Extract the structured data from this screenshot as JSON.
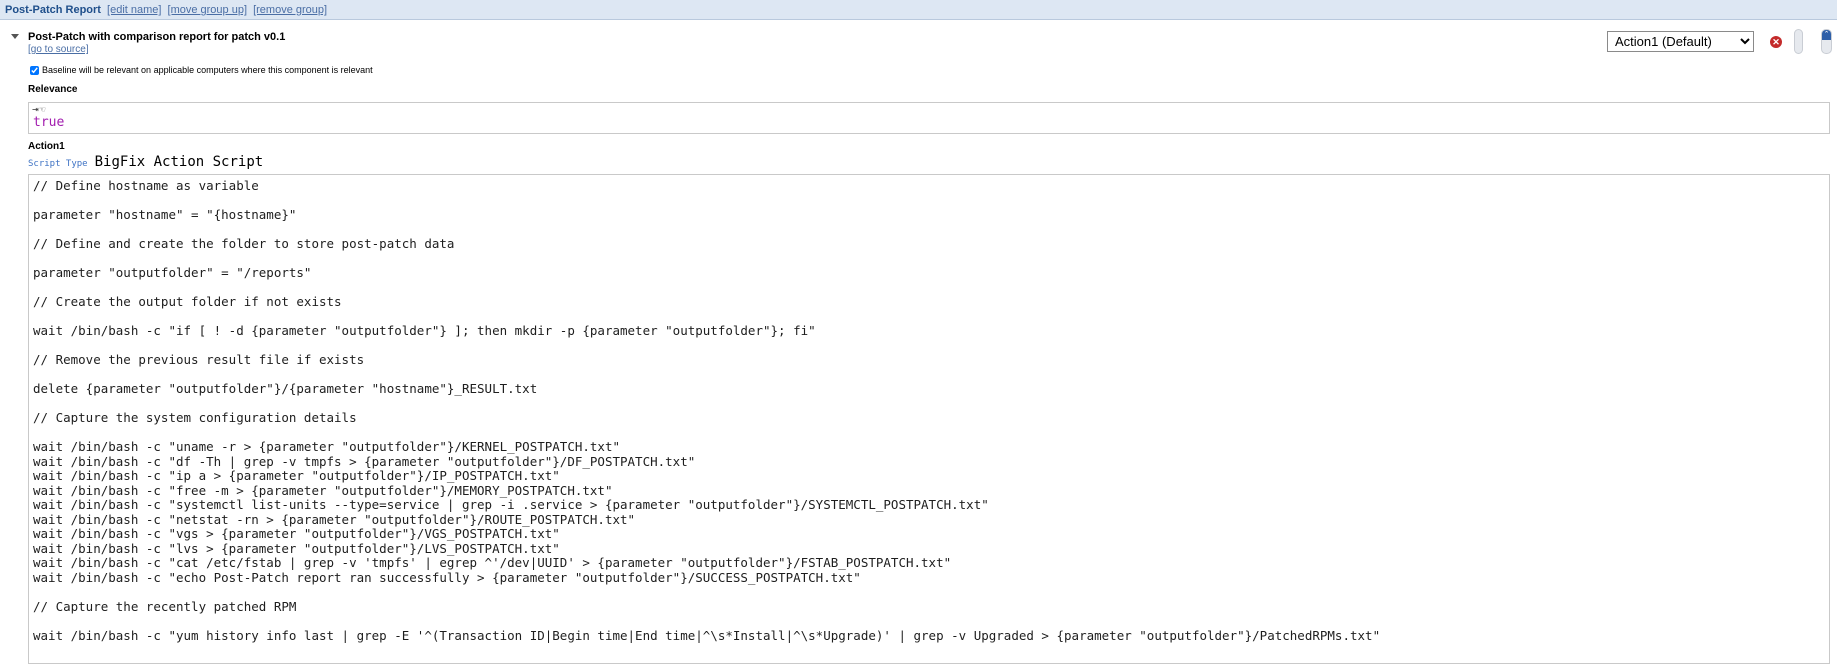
{
  "group": {
    "name": "Post-Patch Report",
    "links": [
      "[edit name]",
      "[move group up]",
      "[remove group]"
    ]
  },
  "component": {
    "title": "Post-Patch with comparison report for patch v0.1",
    "source_link": "[go to source]",
    "action_selector": {
      "selected": "Action1 (Default)"
    },
    "baseline_checkbox": {
      "label": "Baseline will be relevant on applicable computers where this component is relevant",
      "checked": true
    }
  },
  "relevance": {
    "label": "Relevance",
    "value": "true"
  },
  "action": {
    "name": "Action1",
    "script_type_label": "Script Type",
    "script_type": "BigFix Action Script",
    "script_lines": [
      "// Define hostname as variable",
      "",
      "parameter \"hostname\" = \"{hostname}\"",
      "",
      "// Define and create the folder to store post-patch data",
      "",
      "parameter \"outputfolder\" = \"/reports\"",
      "",
      "// Create the output folder if not exists",
      "",
      "wait /bin/bash -c \"if [ ! -d {parameter \"outputfolder\"} ]; then mkdir -p {parameter \"outputfolder\"}; fi\"",
      "",
      "// Remove the previous result file if exists",
      "",
      "delete {parameter \"outputfolder\"}/{parameter \"hostname\"}_RESULT.txt",
      "",
      "// Capture the system configuration details",
      "",
      "wait /bin/bash -c \"uname -r > {parameter \"outputfolder\"}/KERNEL_POSTPATCH.txt\"",
      "wait /bin/bash -c \"df -Th | grep -v tmpfs > {parameter \"outputfolder\"}/DF_POSTPATCH.txt\"",
      "wait /bin/bash -c \"ip a > {parameter \"outputfolder\"}/IP_POSTPATCH.txt\"",
      "wait /bin/bash -c \"free -m > {parameter \"outputfolder\"}/MEMORY_POSTPATCH.txt\"",
      "wait /bin/bash -c \"systemctl list-units --type=service | grep -i .service > {parameter \"outputfolder\"}/SYSTEMCTL_POSTPATCH.txt\"",
      "wait /bin/bash -c \"netstat -rn > {parameter \"outputfolder\"}/ROUTE_POSTPATCH.txt\"",
      "wait /bin/bash -c \"vgs > {parameter \"outputfolder\"}/VGS_POSTPATCH.txt\"",
      "wait /bin/bash -c \"lvs > {parameter \"outputfolder\"}/LVS_POSTPATCH.txt\"",
      "wait /bin/bash -c \"cat /etc/fstab | grep -v 'tmpfs' | egrep ^'/dev|UUID' > {parameter \"outputfolder\"}/FSTAB_POSTPATCH.txt\"",
      "wait /bin/bash -c \"echo Post-Patch report ran successfully > {parameter \"outputfolder\"}/SUCCESS_POSTPATCH.txt\"",
      "",
      "// Capture the recently patched RPM",
      "",
      "wait /bin/bash -c \"yum history info last | grep -E '^(Transaction ID|Begin time|End time|^\\s*Install|^\\s*Upgrade)' | grep -v Upgraded > {parameter \"outputfolder\"}/PatchedRPMs.txt\""
    ]
  }
}
